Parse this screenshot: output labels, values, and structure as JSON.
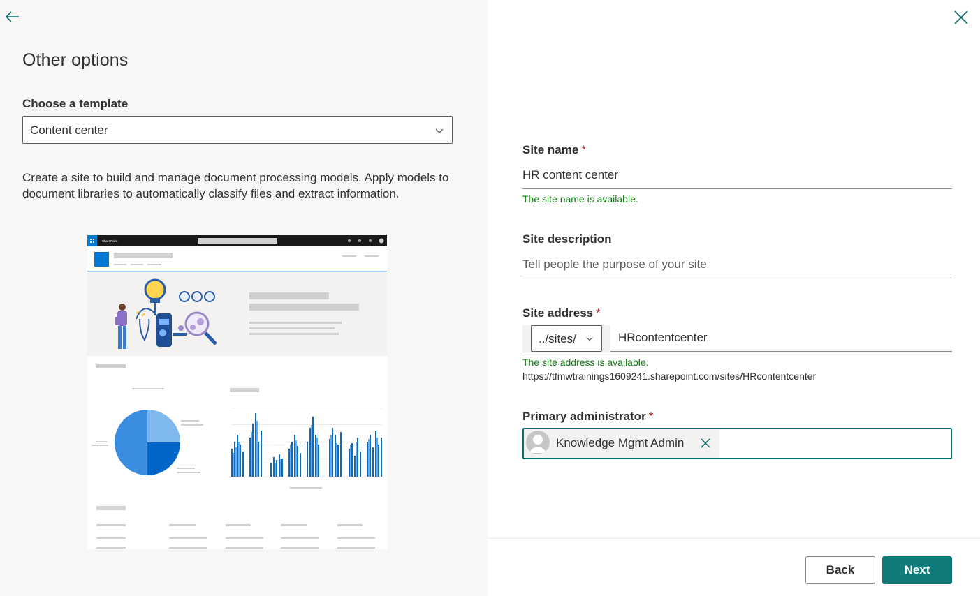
{
  "header": {
    "title": "Other options"
  },
  "template": {
    "label": "Choose a template",
    "selected": "Content center",
    "description": "Create a site to build and manage document processing models. Apply models to document libraries to automatically classify files and extract information."
  },
  "preview": {
    "app_name": "SharePoint"
  },
  "form": {
    "site_name": {
      "label": "Site name",
      "required_mark": "*",
      "value": "HR content center",
      "status": "The site name is available."
    },
    "site_description": {
      "label": "Site description",
      "placeholder": "Tell people the purpose of your site"
    },
    "site_address": {
      "label": "Site address",
      "required_mark": "*",
      "prefix": "../sites/",
      "value": "HRcontentcenter",
      "status": "The site address is available.",
      "url": "https://tfmwtrainings1609241.sharepoint.com/sites/HRcontentcenter"
    },
    "primary_admin": {
      "label": "Primary administrator",
      "required_mark": "*",
      "person": "Knowledge Mgmt Admin"
    }
  },
  "footer": {
    "back_label": "Back",
    "next_label": "Next"
  },
  "colors": {
    "accent": "#0f7b7b",
    "success": "#107c10",
    "required": "#a4262c",
    "preview_blue": "#0078d4"
  },
  "icons": {
    "back": "arrow-left-icon",
    "close": "close-icon",
    "dropdown": "chevron-down-icon",
    "remove": "close-icon",
    "avatar": "person-icon"
  }
}
